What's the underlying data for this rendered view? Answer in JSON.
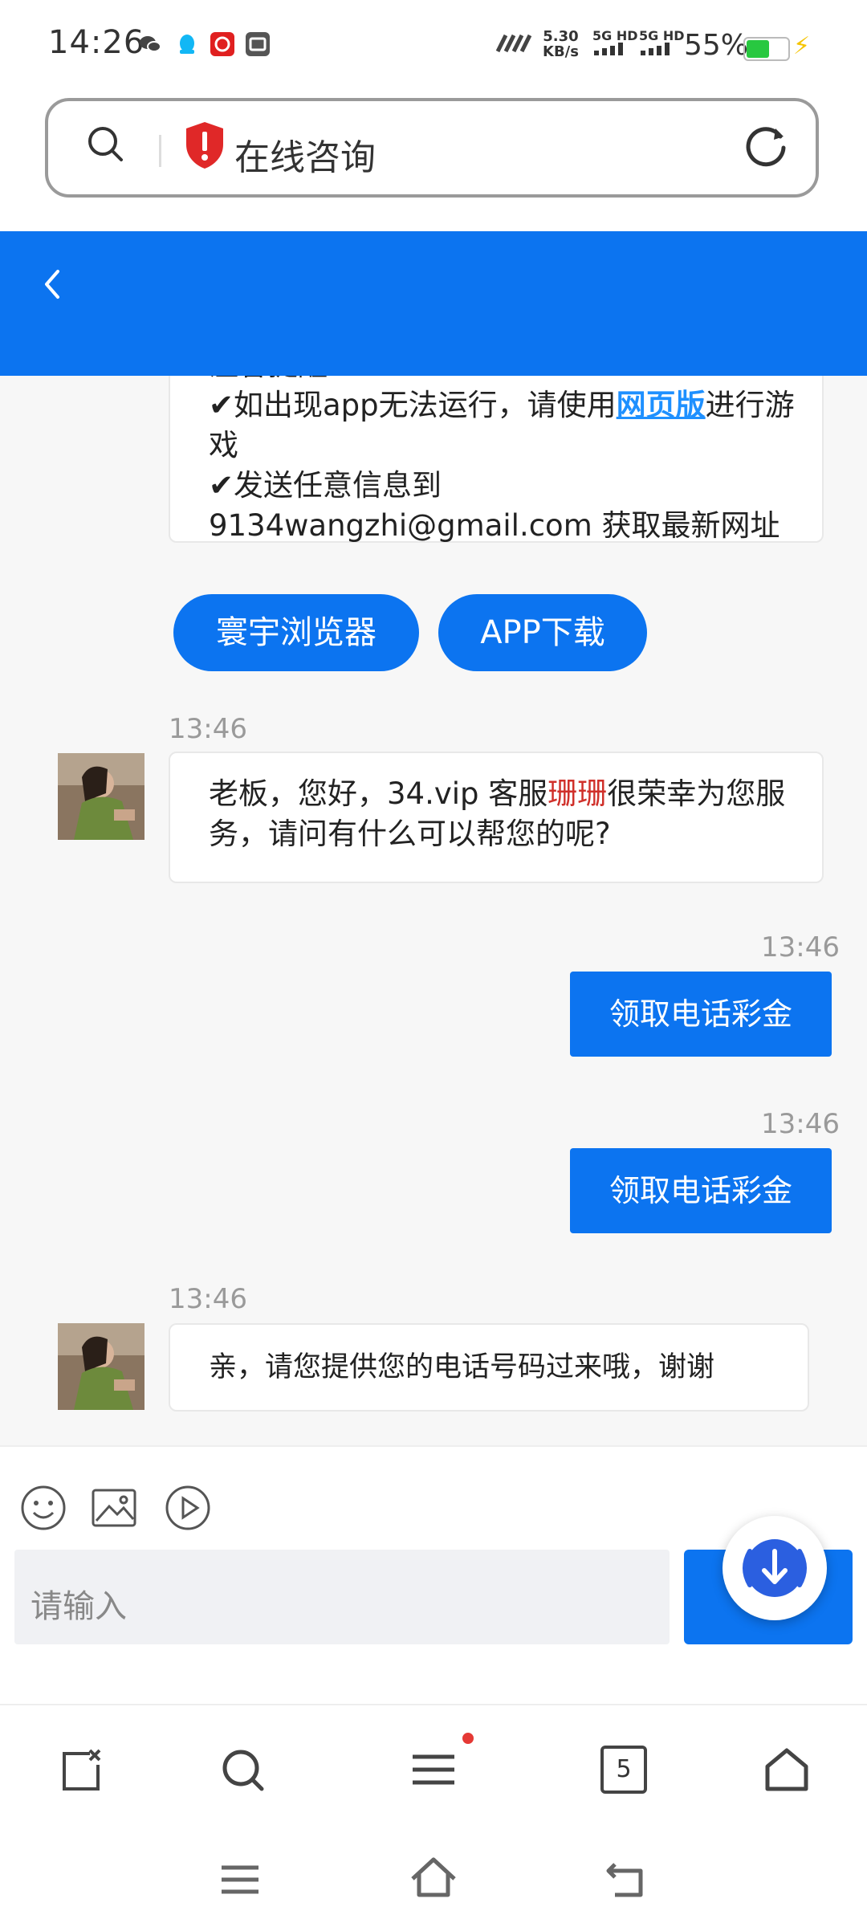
{
  "status_bar": {
    "time": "14:26",
    "net_speed": "5.30",
    "net_unit": "KB/s",
    "sig1": "5G HD",
    "sig2": "5G HD",
    "battery": "55%",
    "battery_level": 0.55
  },
  "address_bar": {
    "title": "在线咨询"
  },
  "chat": {
    "notice_partial": "温馨提醒：",
    "notice_line1_a": "✔如出现app无法运行，请使用",
    "notice_line1_link": "网页版",
    "notice_line1_b": "进行游戏",
    "notice_line2": "✔发送任意信息到",
    "notice_line3": "9134wangzhi@gmail.com 获取最新网址",
    "btn_browser": "寰宇浏览器",
    "btn_app": "APP下载",
    "msg1_time": "13:46",
    "msg1_a": "老板，您好，34.vip 客服",
    "msg1_name": "珊珊",
    "msg1_b": "很荣幸为您服务，请问有什么可以帮您的呢?",
    "out1_time": "13:46",
    "out1_text": "领取电话彩金",
    "out2_time": "13:46",
    "out2_text": "领取电话彩金",
    "msg2_time": "13:46",
    "msg2_text": "亲，请您提供您的电话号码过来哦，谢谢"
  },
  "input": {
    "placeholder": "请输入"
  },
  "browser_bar": {
    "tab_count": "5"
  },
  "colors": {
    "primary": "#0c74f0",
    "link": "#1e90ff",
    "highlight": "#d0302a"
  }
}
